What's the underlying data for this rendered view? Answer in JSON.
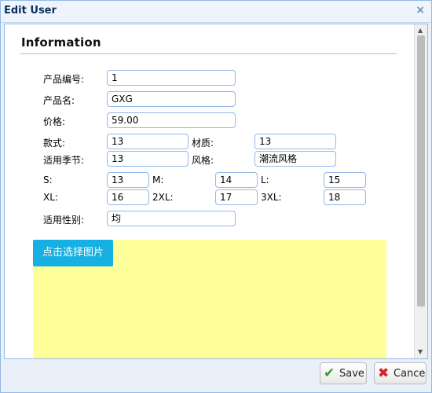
{
  "dialog": {
    "title": "Edit User",
    "close_glyph": "×",
    "close_icon": "close-icon"
  },
  "form": {
    "section_title": "Information",
    "product_code": {
      "label": "产品编号:",
      "value": "1"
    },
    "product_name": {
      "label": "产品名:",
      "value": "GXG"
    },
    "price": {
      "label": "价格:",
      "value": "59.00"
    },
    "style": {
      "label": "款式:",
      "value": "13"
    },
    "material": {
      "label": "材质:",
      "value": "13"
    },
    "season": {
      "label": "适用季节:",
      "value": "13"
    },
    "fashion_style": {
      "label": "风格:",
      "value": "潮流风格"
    },
    "sizes": [
      {
        "label": "S:",
        "value": "13"
      },
      {
        "label": "M:",
        "value": "14"
      },
      {
        "label": "L:",
        "value": "15"
      },
      {
        "label": "XL:",
        "value": "16"
      },
      {
        "label": "2XL:",
        "value": "17"
      },
      {
        "label": "3XL:",
        "value": "18"
      }
    ],
    "gender": {
      "label": "适用性别:",
      "value": "均"
    }
  },
  "upload": {
    "button_label": "点击选择图片",
    "zone_color": "#ffff99",
    "button_color": "#16b0e3"
  },
  "scrollbar": {
    "up_glyph": "▲",
    "down_glyph": "▼"
  },
  "footer": {
    "save_label": "Save",
    "save_icon": "check-icon",
    "save_glyph": "✔",
    "cancel_label": "Cancel",
    "cancel_icon": "cross-icon",
    "cancel_glyph": "✖"
  },
  "colors": {
    "border": "#95b8e7",
    "save_check": "#3a9b2e",
    "cancel_cross": "#e02020"
  }
}
